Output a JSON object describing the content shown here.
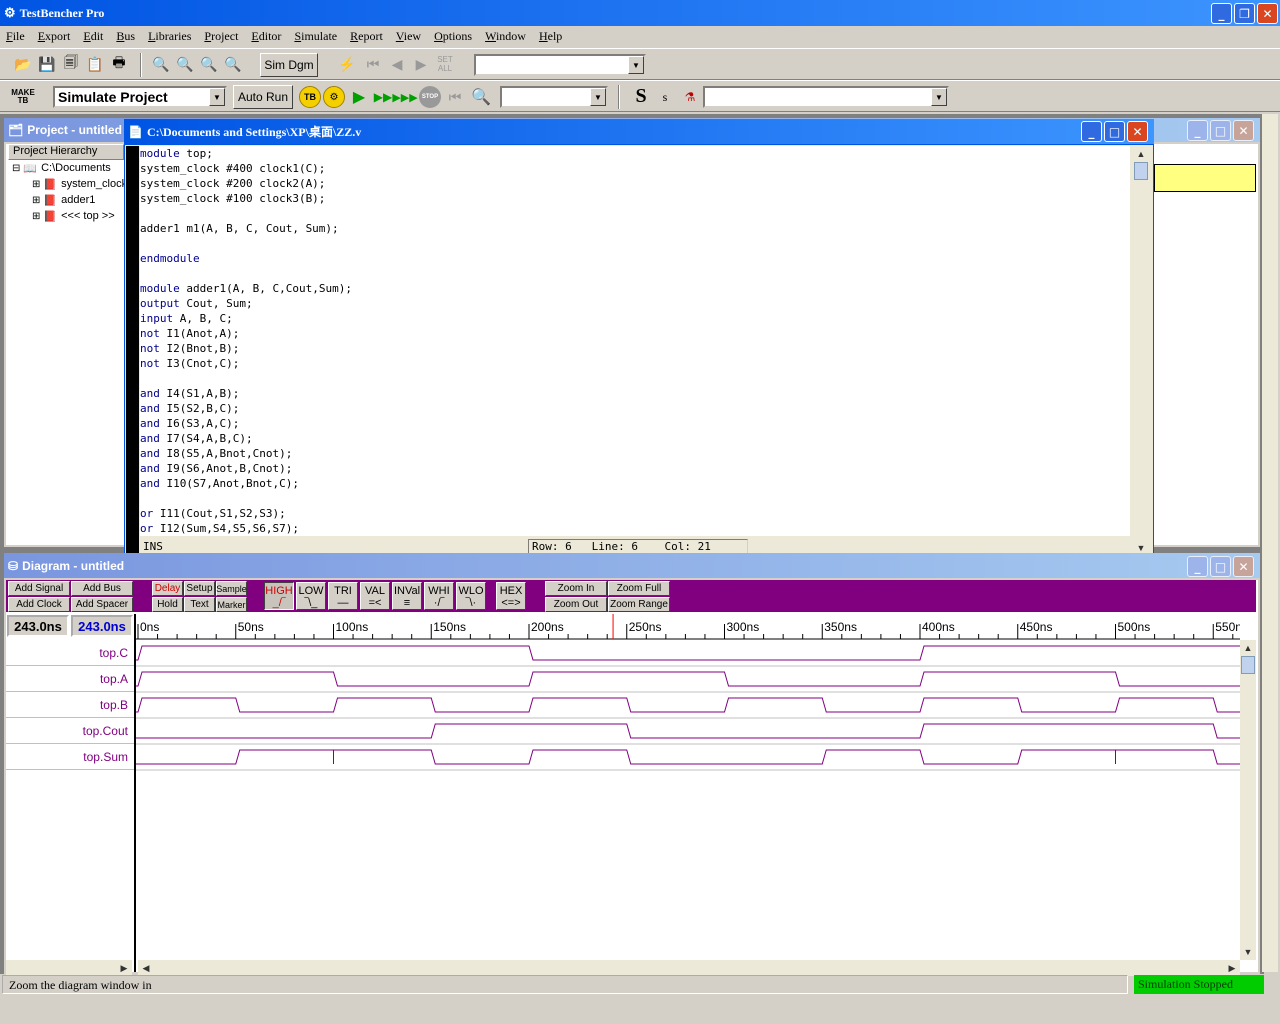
{
  "app": {
    "title": "TestBencher Pro"
  },
  "menu": [
    "File",
    "Export",
    "Edit",
    "Bus",
    "Libraries",
    "Project",
    "Editor",
    "Simulate",
    "Report",
    "View",
    "Options",
    "Window",
    "Help"
  ],
  "toolbar1": {
    "sim_dgm": "Sim Dgm",
    "set_all": "SET ALL"
  },
  "toolbar2": {
    "make_tb": "MAKE TB",
    "project_combo": "Simulate Project",
    "auto_run": "Auto Run",
    "tb": "TB",
    "stop": "STOP",
    "s_big": "S",
    "s_small": "s"
  },
  "project_window": {
    "title": "Project - untitled",
    "tab": "Project Hierarchy",
    "tree": [
      "C:\\Documents",
      "system_clock",
      "adder1",
      "<<< top >>"
    ]
  },
  "editor": {
    "title": "C:\\Documents and Settings\\XP\\桌面\\ZZ.v",
    "lines": [
      [
        "module",
        " top;"
      ],
      [
        "",
        "system_clock #400 clock1(C);"
      ],
      [
        "",
        "system_clock #200 clock2(A);"
      ],
      [
        "",
        "system_clock #100 clock3(B);"
      ],
      [
        "",
        ""
      ],
      [
        "",
        "adder1 m1(A, B, C, Cout, Sum);"
      ],
      [
        "",
        ""
      ],
      [
        "endmodule",
        ""
      ],
      [
        "",
        ""
      ],
      [
        "module",
        " adder1(A, B, C,Cout,Sum);"
      ],
      [
        "output",
        " Cout, Sum;"
      ],
      [
        "input",
        " A, B, C;"
      ],
      [
        "not",
        " I1(Anot,A);"
      ],
      [
        "not",
        " I2(Bnot,B);"
      ],
      [
        "not",
        " I3(Cnot,C);"
      ],
      [
        "",
        ""
      ],
      [
        "and",
        " I4(S1,A,B);"
      ],
      [
        "and",
        " I5(S2,B,C);"
      ],
      [
        "and",
        " I6(S3,A,C);"
      ],
      [
        "and",
        " I7(S4,A,B,C);"
      ],
      [
        "and",
        " I8(S5,A,Bnot,Cnot);"
      ],
      [
        "and",
        " I9(S6,Anot,B,Cnot);"
      ],
      [
        "and",
        " I10(S7,Anot,Bnot,C);"
      ],
      [
        "",
        ""
      ],
      [
        "or",
        " I11(Cout,S1,S2,S3);"
      ],
      [
        "or",
        " I12(Sum,S4,S5,S6,S7);"
      ]
    ],
    "status": {
      "mode": "INS",
      "row": "Row: 6",
      "line": "Line: 6",
      "col": "Col: 21"
    }
  },
  "diagram": {
    "title": "Diagram - untitled",
    "buttons": {
      "add_signal": "Add Signal",
      "add_bus": "Add Bus",
      "add_clock": "Add Clock",
      "add_spacer": "Add Spacer",
      "delay": "Delay",
      "setup": "Setup",
      "sample": "Sample",
      "hold": "Hold",
      "text": "Text",
      "marker": "Marker",
      "high": "HIGH",
      "low": "LOW",
      "tri": "TRI",
      "val": "VAL",
      "inval": "INVal",
      "whi": "WHI",
      "wlo": "WLO",
      "hex": "HEX",
      "zoom_in": "Zoom In",
      "zoom_full": "Zoom Full",
      "zoom_out": "Zoom Out",
      "zoom_range": "Zoom Range"
    },
    "time1": "243.0ns",
    "time2": "243.0ns",
    "ticks": [
      "0ns",
      "50ns",
      "100ns",
      "150ns",
      "200ns",
      "250ns",
      "300ns",
      "350ns",
      "400ns",
      "450ns",
      "500ns",
      "550ns"
    ],
    "signals": [
      {
        "name": "top.C",
        "edges": [
          0,
          200,
          400
        ],
        "init": 0
      },
      {
        "name": "top.A",
        "edges": [
          0,
          100,
          200,
          300,
          400,
          500
        ],
        "init": 0
      },
      {
        "name": "top.B",
        "edges": [
          0,
          50,
          100,
          150,
          200,
          250,
          300,
          350,
          400,
          450,
          500,
          550
        ],
        "init": 0
      },
      {
        "name": "top.Cout",
        "edges": [
          150,
          250,
          400,
          550
        ],
        "init": 0
      },
      {
        "name": "top.Sum",
        "edges": [
          50,
          150,
          200,
          250,
          350,
          400,
          450,
          550
        ],
        "init": 0,
        "glitches": [
          100,
          500
        ]
      }
    ],
    "marker_ns": 243,
    "max_ns": 565
  },
  "statusbar": {
    "hint": "Zoom the diagram window in",
    "sim": "Simulation Stopped"
  },
  "colors": {
    "wave": "#800080",
    "toolbar_bg": "#800080",
    "highlight": "#ffff80",
    "sim_status": "#00cc00"
  }
}
